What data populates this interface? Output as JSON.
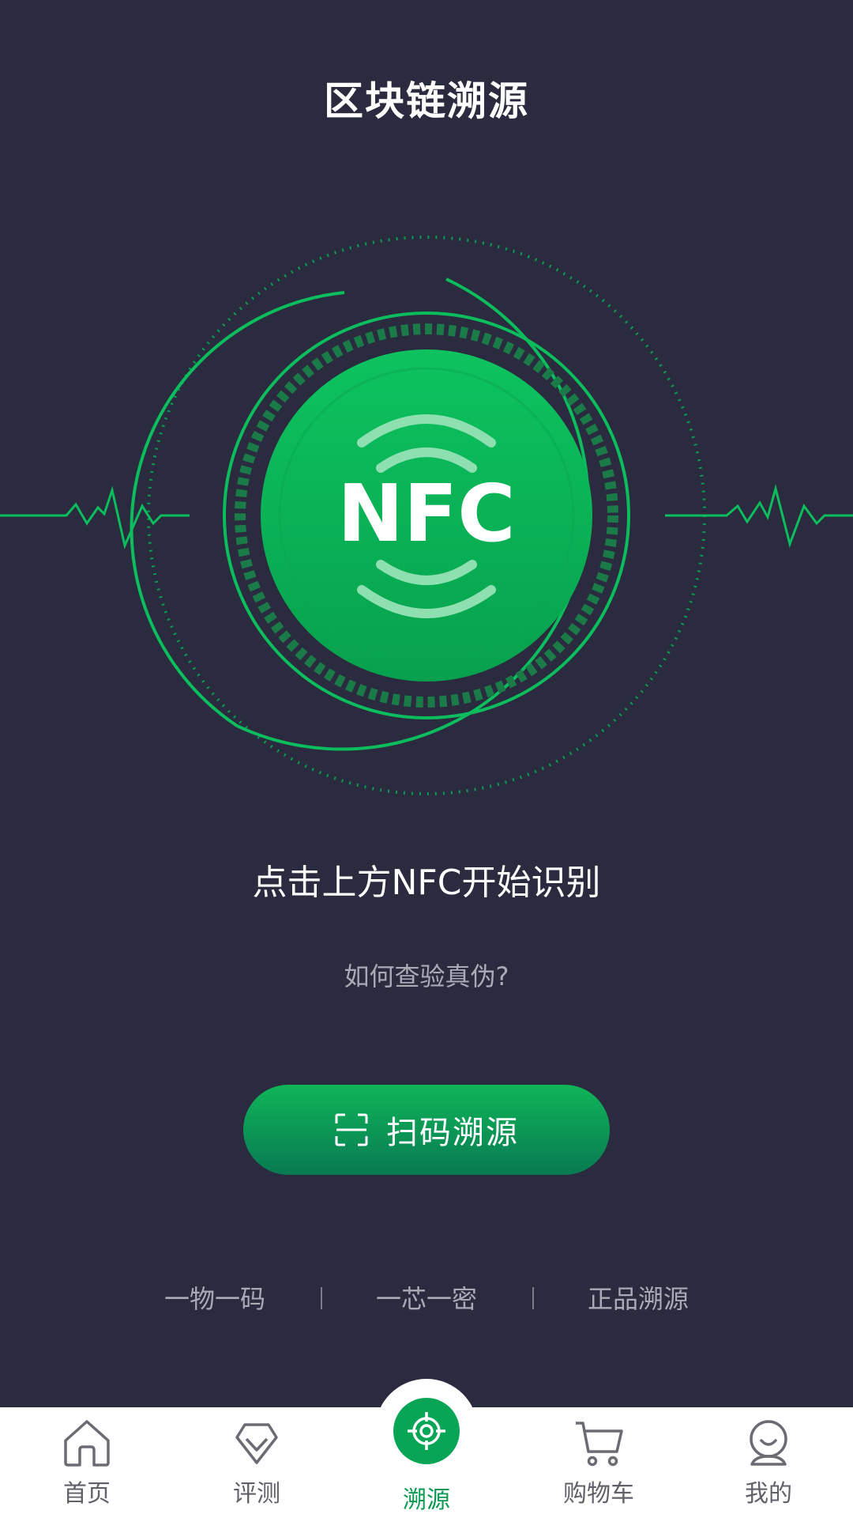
{
  "header": {
    "title": "区块链溯源"
  },
  "nfc": {
    "label": "NFC"
  },
  "main": {
    "instruction": "点击上方NFC开始识别",
    "verify_link": "如何查验真伪?",
    "scan_button_label": "扫码溯源"
  },
  "features": {
    "items": [
      "一物一码",
      "一芯一密",
      "正品溯源"
    ]
  },
  "tabbar": {
    "items": [
      {
        "label": "首页",
        "icon": "home-icon"
      },
      {
        "label": "评测",
        "icon": "diamond-icon"
      },
      {
        "label": "溯源",
        "icon": "target-icon",
        "active": true
      },
      {
        "label": "购物车",
        "icon": "cart-icon"
      },
      {
        "label": "我的",
        "icon": "profile-icon"
      }
    ]
  },
  "colors": {
    "background": "#2a2b3e",
    "accent_green": "#09a556",
    "light_green": "#0fb558",
    "muted_text": "#a9aab5",
    "tab_text": "#5f6068"
  }
}
